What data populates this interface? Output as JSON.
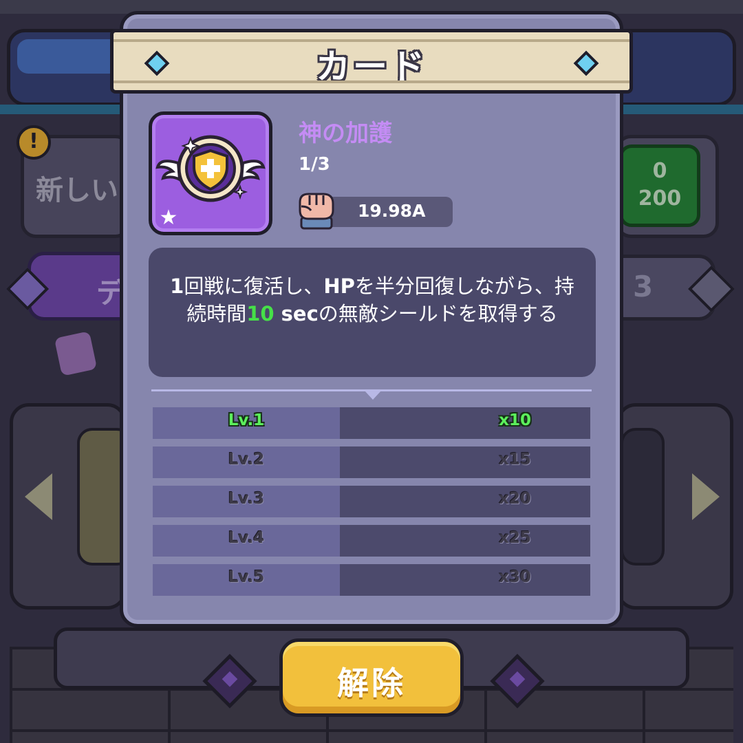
{
  "background": {
    "notice_text": "新しい",
    "left_tab_text": "デ",
    "right_tab_number": "3",
    "green_button_line1": "0",
    "green_button_line2": "200",
    "alert_glyph": "!"
  },
  "dialog": {
    "title": "カード",
    "card": {
      "icon": "winged-shield-plus-icon",
      "name": "神の加護",
      "count": "1/3",
      "power_icon": "fist-icon",
      "power": "19.98A",
      "star_icon": "star-icon"
    },
    "description": {
      "part1_bold": "1",
      "part2": "回戦に復活し、",
      "part3_bold": "HP",
      "part4": "を半分回復しながら、持続時間",
      "part5_highlight": "10",
      "part6_bold": " sec",
      "part7": "の無敵シールドを取得する"
    },
    "levels": [
      {
        "label": "Lv.1",
        "value": "x10",
        "active": true
      },
      {
        "label": "Lv.2",
        "value": "x15",
        "active": false
      },
      {
        "label": "Lv.3",
        "value": "x20",
        "active": false
      },
      {
        "label": "Lv.4",
        "value": "x25",
        "active": false
      },
      {
        "label": "Lv.5",
        "value": "x30",
        "active": false
      }
    ]
  },
  "release_button": {
    "label": "解除"
  },
  "colors": {
    "dialog_bg": "#8686ad",
    "title_bar": "#e8dcbf",
    "card_bg": "#9c5ee0",
    "card_name": "#c48cf4",
    "highlight_green": "#46e048",
    "button_gold": "#f2c03c"
  }
}
